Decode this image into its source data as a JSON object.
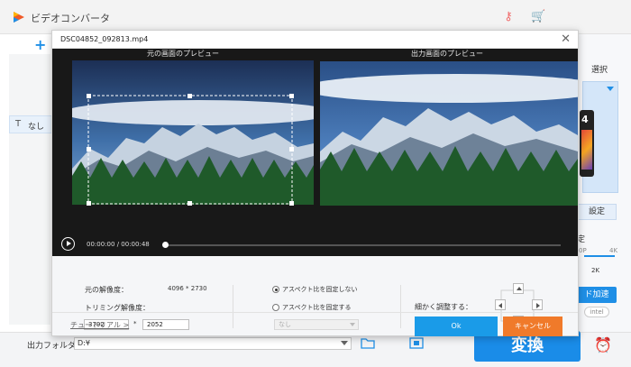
{
  "app": {
    "title": "ビデオコンバータ",
    "subtitle_label": "なし",
    "right_panel": {
      "select_label": "選択",
      "format_number": "4",
      "settings_button": "設定",
      "resolution_label": "定",
      "slider_min": "0P",
      "slider_max": "4K",
      "slider_value": "2K",
      "hw_accel": "ド加速",
      "intel_label": "intel"
    },
    "bottom": {
      "output_folder_label": "出力フォルダ：",
      "output_folder_value": "D:¥",
      "convert_button": "変換"
    }
  },
  "dialog": {
    "file_name": "DSC04852_092813.mp4",
    "original_preview_label": "元の画面のプレビュー",
    "output_preview_label": "出力画面のプレビュー",
    "time_current": "00:00:00",
    "time_separator": "/",
    "time_total": "00:00:48",
    "original_resolution_label": "元の解像度：",
    "original_resolution_value": "4096 * 2730",
    "trim_resolution_label": "トリミング解像度：",
    "trim_width": "3792",
    "trim_times": "*",
    "trim_height": "2052",
    "aspect_unlock_label": "アスペクト比を固定しない",
    "aspect_lock_label": "アスペクト比を固定する",
    "aspect_select_value": "なし",
    "fine_adjust_label": "細かく調整する：",
    "tutorial_link": "チュートリアル >",
    "ok_button": "Ok",
    "cancel_button": "キャンセル"
  },
  "colors": {
    "accent_blue": "#1a9be8",
    "cancel_orange": "#f07a2a",
    "preview_bg": "#181818"
  }
}
